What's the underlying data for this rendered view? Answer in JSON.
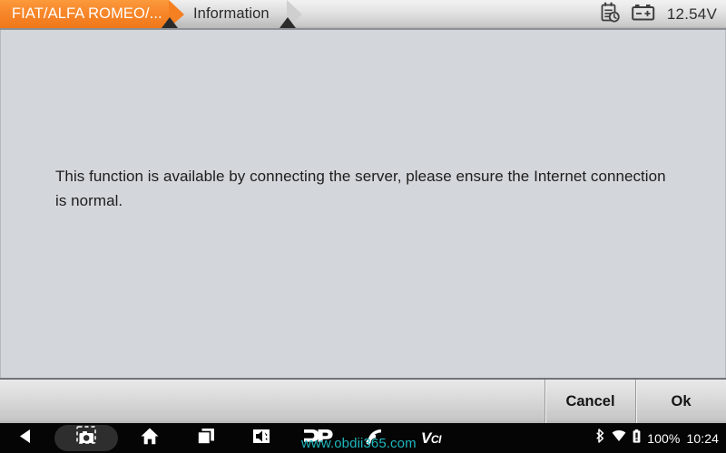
{
  "top_tabs": [
    {
      "label": "FIAT/ALFA ROMEO/...",
      "active": true,
      "name": "tab-vehicle"
    },
    {
      "label": "Information",
      "active": false,
      "name": "tab-information"
    }
  ],
  "top_status": {
    "report_icon": "report-clock-icon",
    "battery_icon": "car-battery-icon",
    "voltage": "12.54V"
  },
  "content": {
    "message": "This function is available by connecting the server,  please ensure the Internet connection is normal."
  },
  "buttons": {
    "cancel_label": "Cancel",
    "ok_label": "Ok"
  },
  "navbar": {
    "back_icon": "back-triangle-icon",
    "screenshot_icon": "screenshot-camera-icon",
    "home_icon": "home-icon",
    "recents_icon": "recents-square-icon",
    "volume_icon": "volume-icon",
    "dp_logo": "dp-logo-icon",
    "signal_icon": "signal-waves-icon",
    "vci_label": "VCI",
    "watermark": "www.obdii365.com",
    "bluetooth_icon": "bluetooth-icon",
    "wifi_icon": "wifi-icon",
    "battery_icon": "battery-icon",
    "battery_percent": "100%",
    "clock": "10:24"
  },
  "colors": {
    "accent_orange": "#f5831f",
    "content_bg": "#d3d7db",
    "watermark_teal": "#1fb6bd"
  }
}
